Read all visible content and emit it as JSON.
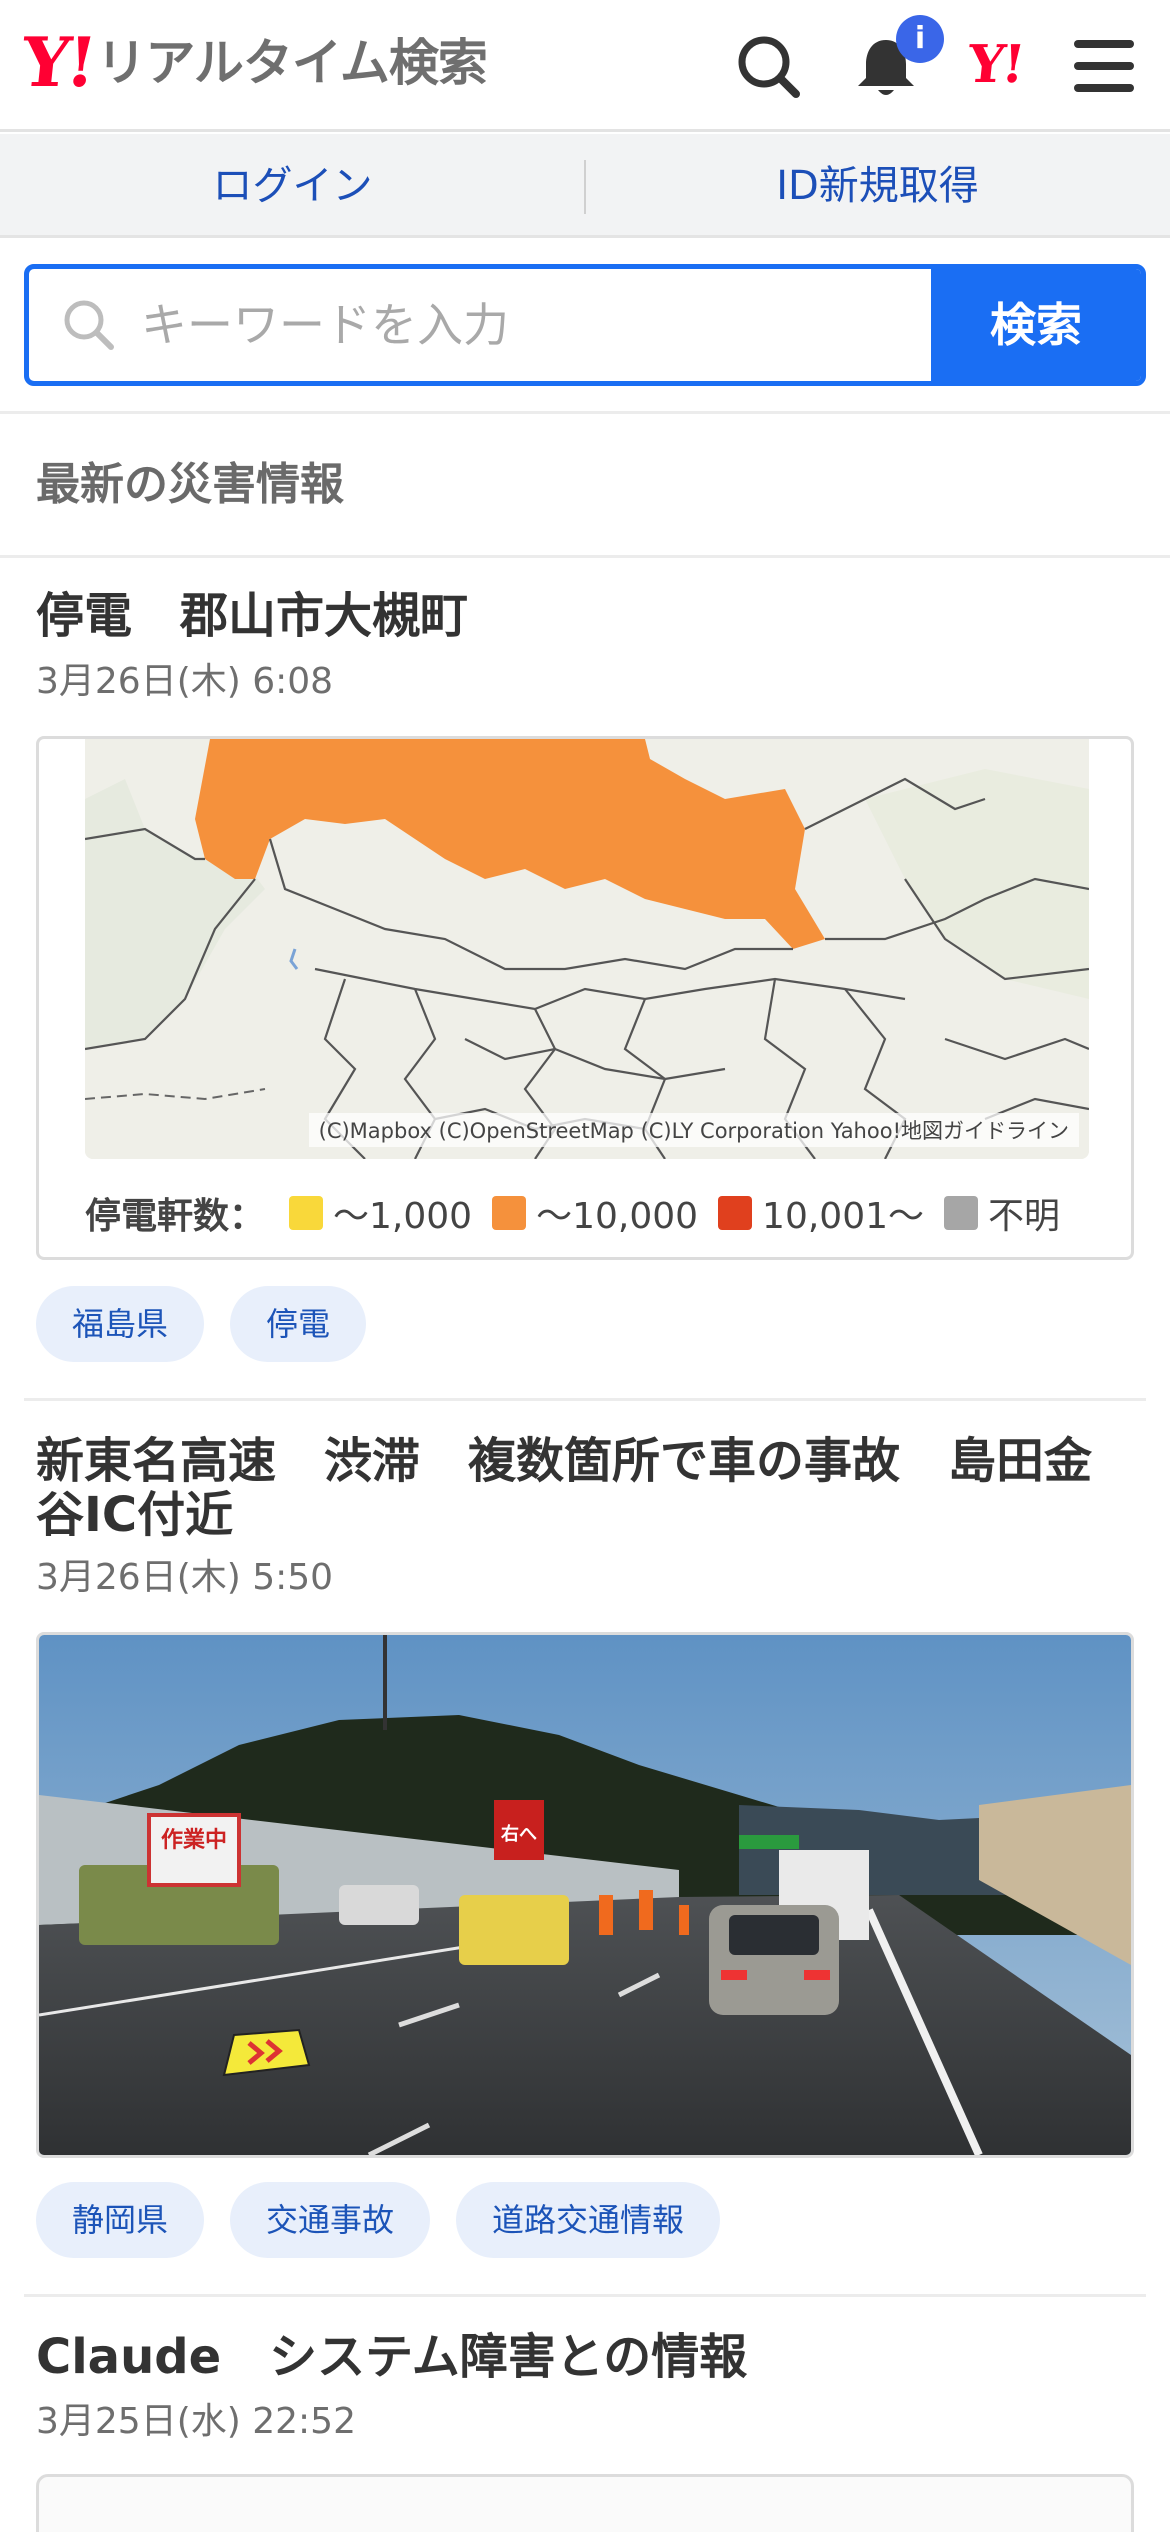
{
  "header": {
    "logo_y": "Y!",
    "logo_text": "リアルタイム検索",
    "notification_badge": "i",
    "yahoo_mark": "Y!"
  },
  "auth": {
    "login": "ログイン",
    "register": "ID新規取得"
  },
  "search": {
    "placeholder": "キーワードを入力",
    "button": "検索"
  },
  "section": {
    "title": "最新の災害情報"
  },
  "articles": [
    {
      "title": "停電　郡山市大槻町",
      "time": "3月26日(木) 6:08",
      "map": {
        "credit": "(C)Mapbox (C)OpenStreetMap (C)LY Corporation Yahoo!地図ガイドライン",
        "legend_label": "停電軒数：",
        "legend": [
          {
            "label": "〜1,000",
            "color": "#f9d83a"
          },
          {
            "label": "〜10,000",
            "color": "#f5913c"
          },
          {
            "label": "10,001〜",
            "color": "#e0401e"
          },
          {
            "label": "不明",
            "color": "#a6a6a6"
          }
        ]
      },
      "tags": [
        "福島県",
        "停電"
      ]
    },
    {
      "title": "新東名高速　渋滞　複数箇所で車の事故　島田金谷IC付近",
      "time": "3月26日(木) 5:50",
      "photo": {
        "sign_work": "作業中",
        "sign_right": "右へ"
      },
      "tags": [
        "静岡県",
        "交通事故",
        "道路交通情報"
      ]
    },
    {
      "title": "Claude　システム障害との情報",
      "time": "3月25日(水) 22:52"
    }
  ],
  "colors": {
    "accent": "#1a6ef3",
    "brand": "#ff0033",
    "tag_bg": "#e8effb",
    "tag_text": "#1c54b8",
    "outage_orange": "#f5913c"
  }
}
